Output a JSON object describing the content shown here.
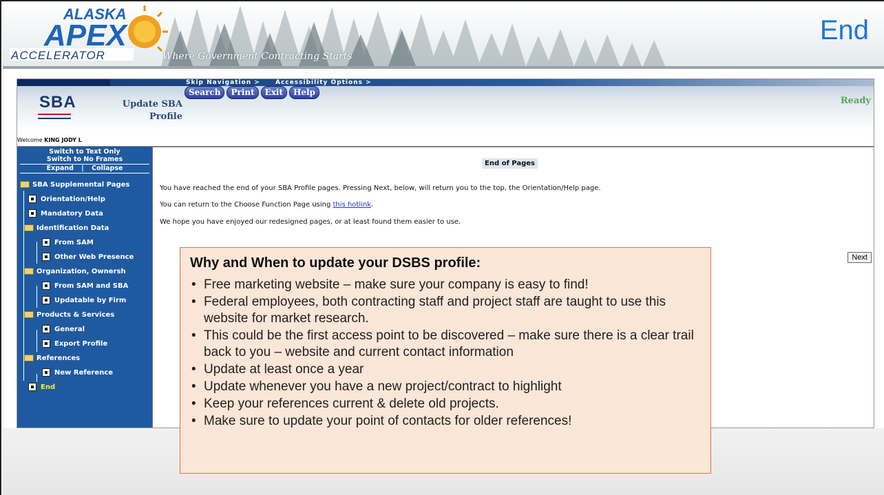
{
  "slide": {
    "title": "End",
    "tagline": "Where Government Contracting Starts",
    "logo": {
      "line1": "ALASKA",
      "line2": "APEX",
      "line3": "ACCELERATOR"
    }
  },
  "app": {
    "title_line1": "Update SBA",
    "title_line2": "Profile",
    "sba_logo_text": "SBA",
    "skip_nav": "Skip Navigation >",
    "accessibility": "Accessibility Options >",
    "toolbar": [
      "Search",
      "Print",
      "Exit",
      "Help"
    ],
    "status": "Ready",
    "welcome_prefix": "Welcome",
    "welcome_user": "KING JODY L"
  },
  "nav": {
    "switch_text": "Switch to Text Only",
    "switch_frames": "Switch to No Frames",
    "expand": "Expand",
    "separator": "|",
    "collapse": "Collapse",
    "items": [
      {
        "label": "SBA Supplemental Pages",
        "kind": "folder"
      },
      {
        "label": "Orientation/Help",
        "kind": "page"
      },
      {
        "label": "Mandatory Data",
        "kind": "page"
      },
      {
        "label": "Identification Data",
        "kind": "folder"
      },
      {
        "label": "From SAM",
        "kind": "page"
      },
      {
        "label": "Other Web Presence",
        "kind": "page"
      },
      {
        "label": "Organization, Ownersh",
        "kind": "folder"
      },
      {
        "label": "From SAM and SBA",
        "kind": "page"
      },
      {
        "label": "Updatable by Firm",
        "kind": "page"
      },
      {
        "label": "Products & Services",
        "kind": "folder"
      },
      {
        "label": "General",
        "kind": "page"
      },
      {
        "label": "Export Profile",
        "kind": "page"
      },
      {
        "label": "References",
        "kind": "folder"
      },
      {
        "label": "New Reference",
        "kind": "page"
      },
      {
        "label": "End",
        "kind": "page"
      }
    ]
  },
  "main": {
    "heading": "End of Pages",
    "para1": "You have reached the end of your SBA Profile pages. Pressing Next, below, will return you to the top, the Orientation/Help page.",
    "para2_prefix": "You can return to the Choose Function Page using ",
    "para2_link": "this hotlink",
    "para2_suffix": ".",
    "para3": "We hope you have enjoyed our redesigned pages, or at least found them easier to use.",
    "next_label": "Next"
  },
  "callout": {
    "title": "Why and When to update your DSBS profile:",
    "bullets": [
      "Free marketing website – make sure your company is easy to find!",
      "Federal employees, both contracting staff and project staff are taught to use this website for market research.",
      "This could be the first access point to be discovered – make sure there is a clear trail back to you – website and current contact information",
      "Update at least once a year",
      "Update whenever you have a new project/contract to highlight",
      "Keep your references current & delete old projects.",
      "Make sure to update your point of contacts for older references!"
    ]
  },
  "colors": {
    "title_blue": "#1f77d0",
    "nav_blue": "#1f5aa0",
    "callout_bg": "#fbe6d7",
    "callout_border": "#d77a4a",
    "ready_green": "#5aa84e",
    "end_yellow": "#ffeb3b"
  }
}
